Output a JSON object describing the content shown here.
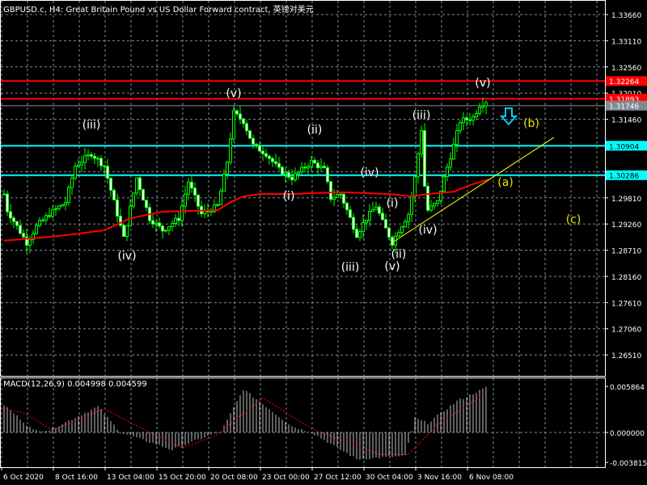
{
  "header": {
    "title": "GBPUSD.c, H4:  Great Britain Pound vs US Dollar Forward contract, 英镑对美元"
  },
  "colors": {
    "background": "#000000",
    "candle": "#00ff00",
    "grid": "#7f8b99",
    "ma": "#ff0000",
    "resistance": "#ff0000",
    "support": "#00ffff",
    "bid": "#808a94",
    "trendline": "#ffff00"
  },
  "chart_data": [
    {
      "type": "candlestick",
      "title": "GBPUSD.c, H4",
      "ylim": [
        1.2596,
        1.3394
      ],
      "price_ticks": [
        "1.33660",
        "1.33110",
        "1.32560",
        "1.32010",
        "1.31460",
        "1.29810",
        "1.29260",
        "1.28710",
        "1.28160",
        "1.27610",
        "1.27060",
        "1.26510"
      ],
      "time_labels": [
        "6 Oct 2020",
        "8 Oct 16:00",
        "13 Oct 04:00",
        "15 Oct 20:00",
        "20 Oct 08:00",
        "23 Oct 00:00",
        "27 Oct 12:00",
        "30 Oct 04:00",
        "3 Nov 16:00",
        "6 Nov 08:00"
      ],
      "bar_count": 150,
      "close_path": [
        [
          0,
          1.2989
        ],
        [
          1,
          1.2955
        ],
        [
          4,
          1.2921
        ],
        [
          7,
          1.2887
        ],
        [
          10,
          1.2921
        ],
        [
          14,
          1.2947
        ],
        [
          19,
          1.2972
        ],
        [
          22,
          1.3048
        ],
        [
          27,
          1.3074
        ],
        [
          31,
          1.3048
        ],
        [
          34,
          1.2972
        ],
        [
          37,
          1.2896
        ],
        [
          41,
          1.3023
        ],
        [
          45,
          1.2938
        ],
        [
          49,
          1.2913
        ],
        [
          54,
          1.2938
        ],
        [
          57,
          1.3015
        ],
        [
          61,
          1.2947
        ],
        [
          66,
          1.2964
        ],
        [
          69,
          1.3057
        ],
        [
          71,
          1.3159
        ],
        [
          74,
          1.3142
        ],
        [
          77,
          1.3091
        ],
        [
          81,
          1.3074
        ],
        [
          85,
          1.304
        ],
        [
          89,
          1.3023
        ],
        [
          92,
          1.304
        ],
        [
          95,
          1.3057
        ],
        [
          99,
          1.304
        ],
        [
          101,
          1.2981
        ],
        [
          104,
          1.2989
        ],
        [
          106,
          1.2955
        ],
        [
          109,
          1.2904
        ],
        [
          112,
          1.2938
        ],
        [
          115,
          1.2964
        ],
        [
          117,
          1.293
        ],
        [
          120,
          1.2887
        ],
        [
          122,
          1.2913
        ],
        [
          125,
          1.2947
        ],
        [
          127,
          1.3023
        ],
        [
          129,
          1.3125
        ],
        [
          130,
          1.3006
        ],
        [
          131,
          1.2955
        ],
        [
          134,
          1.2972
        ],
        [
          136,
          1.3023
        ],
        [
          139,
          1.3091
        ],
        [
          141,
          1.3142
        ],
        [
          145,
          1.315
        ],
        [
          147,
          1.3176
        ],
        [
          149,
          1.3184
        ]
      ],
      "series": [
        {
          "name": "Moving Average",
          "path": [
            [
              0,
              1.2891
            ],
            [
              14,
              1.2899
            ],
            [
              21,
              1.2904
            ],
            [
              31,
              1.2913
            ],
            [
              39,
              1.2938
            ],
            [
              49,
              1.2952
            ],
            [
              66,
              1.2955
            ],
            [
              70,
              1.2972
            ],
            [
              74,
              1.2984
            ],
            [
              79,
              1.2989
            ],
            [
              89,
              1.2989
            ],
            [
              104,
              1.2993
            ],
            [
              119,
              1.2989
            ],
            [
              126,
              1.2984
            ],
            [
              131,
              1.2989
            ],
            [
              139,
              1.2994
            ],
            [
              145,
              1.301
            ],
            [
              150,
              1.302
            ]
          ]
        }
      ],
      "levels": [
        {
          "label": "1.32264",
          "price": 1.32264,
          "kind": "resistance"
        },
        {
          "label": "1.31893",
          "price": 1.31893,
          "kind": "resistance"
        },
        {
          "label": "1.31746",
          "price": 1.31746,
          "kind": "bid"
        },
        {
          "label": "1.30904",
          "price": 1.30904,
          "kind": "support"
        },
        {
          "label": "1.30286",
          "price": 1.30286,
          "kind": "support"
        }
      ],
      "trendline": {
        "from": [
          120,
          1.2887
        ],
        "to": [
          170,
          1.3108
        ]
      },
      "wave_labels": [
        {
          "text": "(iii)",
          "bar": 27,
          "price": 1.3134,
          "color": "white"
        },
        {
          "text": "(iv)",
          "bar": 38,
          "price": 1.2859,
          "color": "white"
        },
        {
          "text": "(v)",
          "bar": 71,
          "price": 1.32,
          "color": "white"
        },
        {
          "text": "(i)",
          "bar": 88,
          "price": 1.2984,
          "color": "white"
        },
        {
          "text": "(ii)",
          "bar": 96,
          "price": 1.3123,
          "color": "white"
        },
        {
          "text": "(iii)",
          "bar": 107,
          "price": 1.2835,
          "color": "white"
        },
        {
          "text": "(iv)",
          "bar": 113,
          "price": 1.3033,
          "color": "white"
        },
        {
          "text": "(i)",
          "bar": 120,
          "price": 1.2969,
          "color": "white"
        },
        {
          "text": "(ii)",
          "bar": 122,
          "price": 1.2862,
          "color": "white"
        },
        {
          "text": "(v)",
          "bar": 120,
          "price": 1.2837,
          "color": "white"
        },
        {
          "text": "(iii)",
          "bar": 129,
          "price": 1.3154,
          "color": "white"
        },
        {
          "text": "(iv)",
          "bar": 131,
          "price": 1.2913,
          "color": "white"
        },
        {
          "text": "(v)",
          "bar": 148,
          "price": 1.3221,
          "color": "white"
        },
        {
          "text": "(b)",
          "bar": 163,
          "price": 1.3137,
          "color": "yellow"
        },
        {
          "text": "(a)",
          "bar": 155,
          "price": 1.3013,
          "color": "yellow"
        },
        {
          "text": "(c)",
          "bar": 176,
          "price": 1.2935,
          "color": "yellow"
        }
      ],
      "arrow": {
        "direction": "down",
        "bar": 156,
        "price": 1.3149
      }
    },
    {
      "type": "bar",
      "title": "MACD(12,26,9) 0.004998 0.004599",
      "ylim": [
        -0.003815,
        0.005864
      ],
      "tick_labels": [
        "0.005864",
        "0.000000",
        "-0.003815"
      ],
      "histogram_path": [
        [
          0,
          0.0035
        ],
        [
          9,
          0.0003
        ],
        [
          14,
          0.0003
        ],
        [
          29,
          0.0033
        ],
        [
          36,
          0.0
        ],
        [
          52,
          -0.0022
        ],
        [
          64,
          -0.0003
        ],
        [
          67,
          0.0
        ],
        [
          74,
          0.0055
        ],
        [
          89,
          0.0008
        ],
        [
          95,
          0.0
        ],
        [
          109,
          -0.0034
        ],
        [
          124,
          -0.003
        ],
        [
          127,
          0.0018
        ],
        [
          131,
          0.0012
        ],
        [
          140,
          0.004
        ],
        [
          149,
          0.0057
        ]
      ],
      "signal_path": [
        [
          0,
          0.003
        ],
        [
          6,
          0.0025
        ],
        [
          15,
          0.0003
        ],
        [
          31,
          0.003
        ],
        [
          45,
          0.0
        ],
        [
          55,
          -0.002
        ],
        [
          65,
          -0.0005
        ],
        [
          80,
          0.0044
        ],
        [
          95,
          0.0005
        ],
        [
          116,
          -0.0028
        ],
        [
          125,
          -0.0028
        ],
        [
          134,
          0.001
        ],
        [
          149,
          0.005
        ]
      ]
    }
  ]
}
